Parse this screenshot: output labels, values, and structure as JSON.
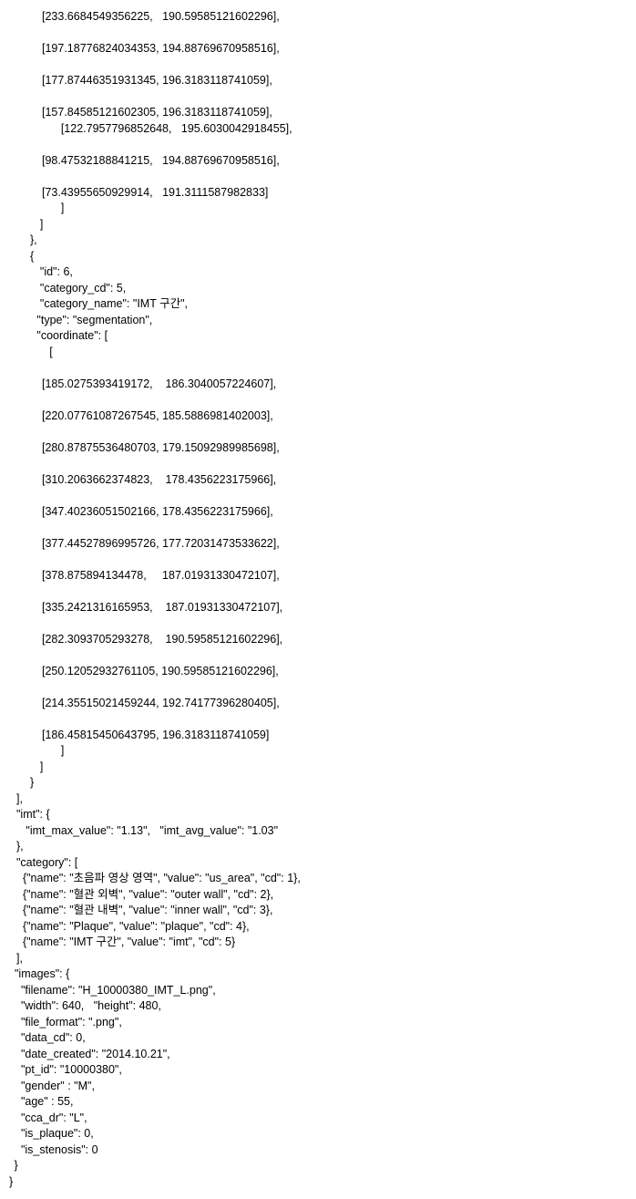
{
  "segment5_coords_tail": [
    "[233.6684549356225,   190.59585121602296],",
    "",
    "[197.18776824034353, 194.88769670958516],",
    "",
    "[177.87446351931345, 196.3183118741059],",
    "",
    "[157.84585121602305, 196.3183118741059],",
    "      [122.7957796852648,   195.6030042918455],",
    "",
    "[98.47532188841215,   194.88769670958516],",
    "",
    "[73.43955650929914,   191.3111587982833]",
    "      ]",
    "    ]",
    "  },",
    "  {"
  ],
  "seg6_id_line": "    \"id\": 6,",
  "seg6_catcd_line": "    \"category_cd\": 5,",
  "seg6_catname_line": "    \"category_name\": \"IMT 구간\",",
  "seg6_type_line": "   \"type\": \"segmentation\",",
  "seg6_coord_open1": "   \"coordinate\": [",
  "seg6_coord_open2": "       [",
  "seg6_coords": [
    "[185.0275393419172,    186.3040057224607],",
    "",
    "[220.07761087267545, 185.5886981402003],",
    "",
    "[280.87875536480703, 179.15092989985698],",
    "",
    "[310.2063662374823,    178.4356223175966],",
    "",
    "[347.40236051502166, 178.4356223175966],",
    "",
    "[377.44527896995726, 177.72031473533622],",
    "",
    "[378.875894134478,     187.01931330472107],",
    "",
    "[335.2421316165953,    187.01931330472107],",
    "",
    "[282.3093705293278,    190.59585121602296],",
    "",
    "[250.12052932761105, 190.59585121602296],",
    "",
    "[214.35515021459244, 192.74177396280405],",
    "",
    "[186.45815450643795, 196.3183118741059]",
    "      ]",
    "    ]",
    "  }",
    "],"
  ],
  "imt_open": "\"imt\": {",
  "imt_values": "   \"imt_max_value\": \"1.13\",   \"imt_avg_value\": \"1.03\"",
  "imt_close": "},",
  "cat_open": "\"category\": [",
  "cat1": "  {\"name\": \"초음파 영상 영역\", \"value\": \"us_area\", \"cd\": 1},",
  "cat2": "  {\"name\": \"혈관 외벽\", \"value\": \"outer wall\", \"cd\": 2},",
  "cat3": "  {\"name\": \"혈관 내벽\", \"value\": \"inner wall\", \"cd\": 3},",
  "cat4": "  {\"name\": \"Plaque\", \"value\": \"plaque\", \"cd\": 4},",
  "cat5": "  {\"name\": \"IMT 구간\", \"value\": \"imt\", \"cd\": 5}",
  "cat_close": "],",
  "img_open": "\"images\": {",
  "img_filename": "  \"filename\": \"H_10000380_IMT_L.png\",",
  "img_wh": "  \"width\": 640,   \"height\": 480,",
  "img_format": "  \"file_format\": \".png\",",
  "img_datacd": "  \"data_cd\": 0,",
  "img_date": "  \"date_created\": \"2014.10.21\",",
  "img_ptid": "  \"pt_id\": \"10000380\",",
  "img_gender": "  \"gender\" : \"M\",",
  "img_age": "  \"age\" : 55,",
  "img_cca": "  \"cca_dr\": \"L\",",
  "img_plaque": "  \"is_plaque\": 0,",
  "img_stenosis": "  \"is_stenosis\": 0",
  "img_close": " }",
  "root_close": "}"
}
